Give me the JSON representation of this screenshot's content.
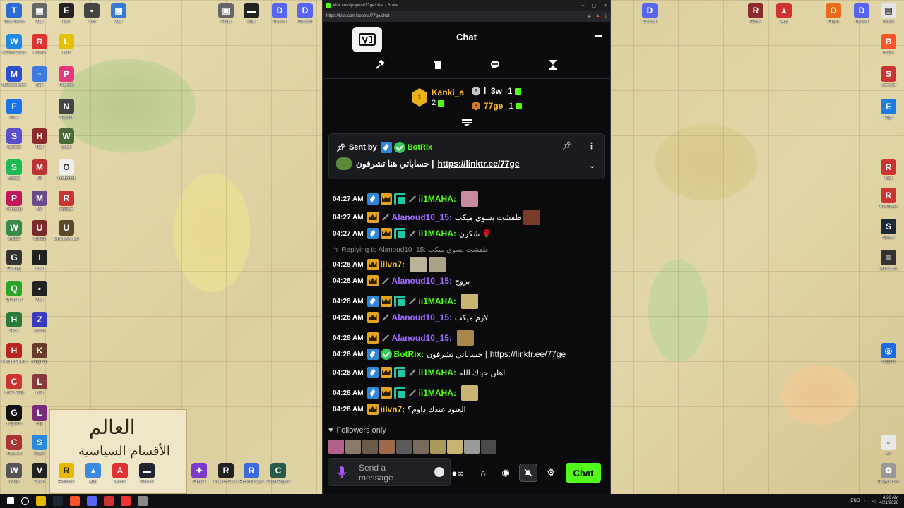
{
  "browser": {
    "tab_title": "kick.com/popout/77ge/chat - Brave",
    "url": "https://kick.com/popout/77ge/chat",
    "window_controls": [
      "–",
      "▢",
      "✕"
    ]
  },
  "chat": {
    "header_title": "Chat",
    "more_label": "•••",
    "toolbar": [
      "gavel-icon",
      "trash-icon",
      "chat-bubble-icon",
      "hourglass-icon"
    ]
  },
  "leaderboard": {
    "first": {
      "rank": "1",
      "name": "Kanki_a",
      "count": "2"
    },
    "second": {
      "rank": "2",
      "name": "l_3w",
      "count": "1"
    },
    "third": {
      "rank": "3",
      "name": "77ge",
      "count": "1"
    }
  },
  "pinned": {
    "sent_by_label": "Sent by",
    "sender": "BotRix",
    "message_text": "حساباتي هنا تشرفون |",
    "link": "https://linktr.ee/77ge"
  },
  "messages": [
    {
      "time": "04:27 AM",
      "badges": [
        "mod",
        "vip",
        "og",
        "sword"
      ],
      "user": "ii1MAHA:",
      "user_color": "green",
      "text": "",
      "emote": "#c78aa0"
    },
    {
      "time": "04:27 AM",
      "badges": [
        "vip",
        "sword"
      ],
      "user": "Alanoud10_15:",
      "user_color": "purple",
      "text": "طفشت بسوي ميكب",
      "emote": "#7a3a2a"
    },
    {
      "time": "04:27 AM",
      "badges": [
        "mod",
        "vip",
        "og",
        "sword"
      ],
      "user": "ii1MAHA:",
      "user_color": "green",
      "text": "شكرن 🌹",
      "emote": ""
    },
    {
      "time": "04:28 AM",
      "badges": [
        "vip"
      ],
      "user": "iilvn7:",
      "user_color": "gold",
      "text": "",
      "emote": "#b9b39a"
    },
    {
      "time": "04:28 AM",
      "badges": [
        "vip",
        "sword"
      ],
      "user": "Alanoud10_15:",
      "user_color": "purple",
      "text": "بروح",
      "emote": ""
    },
    {
      "time": "04:28 AM",
      "badges": [
        "mod",
        "vip",
        "og",
        "sword"
      ],
      "user": "ii1MAHA:",
      "user_color": "green",
      "text": "",
      "emote": "#c9b474"
    },
    {
      "time": "04:28 AM",
      "badges": [
        "vip",
        "sword"
      ],
      "user": "Alanoud10_15:",
      "user_color": "purple",
      "text": "لازم ميكب",
      "emote": ""
    },
    {
      "time": "04:28 AM",
      "badges": [
        "vip",
        "sword"
      ],
      "user": "Alanoud10_15:",
      "user_color": "purple",
      "text": "",
      "emote": "#a8884a"
    },
    {
      "time": "04:28 AM",
      "badges": [
        "mod",
        "verified"
      ],
      "user": "BotRix:",
      "user_color": "green",
      "text": "حساباتي تشرفون |",
      "link": "https://linktr.ee/77ge"
    },
    {
      "time": "04:28 AM",
      "badges": [
        "mod",
        "vip",
        "og",
        "sword"
      ],
      "user": "ii1MAHA:",
      "user_color": "green",
      "text": "اهلن حياك الله",
      "emote": ""
    },
    {
      "time": "04:28 AM",
      "badges": [
        "mod",
        "vip",
        "og",
        "sword"
      ],
      "user": "ii1MAHA:",
      "user_color": "green",
      "text": "",
      "emote": "#c9b474"
    },
    {
      "time": "04:28 AM",
      "badges": [
        "vip"
      ],
      "user": "iilvn7:",
      "user_color": "gold",
      "text": "العنود عندك داوم؟",
      "emote": ""
    }
  ],
  "reply": {
    "text": "Replying to Alanoud10_15: طفشت بسوي ميكب"
  },
  "followers_only": {
    "label": "Followers only"
  },
  "input": {
    "placeholder": "Send a message",
    "chat_button": "Chat"
  },
  "taskbar": {
    "time": "4:28 AM",
    "date": "4/21/2026",
    "lang": "ENG"
  },
  "colors": {
    "kick_green": "#53fc18",
    "purple_user": "#a16bff",
    "gold_user": "#f5c237",
    "background": "#0b0b0d"
  }
}
